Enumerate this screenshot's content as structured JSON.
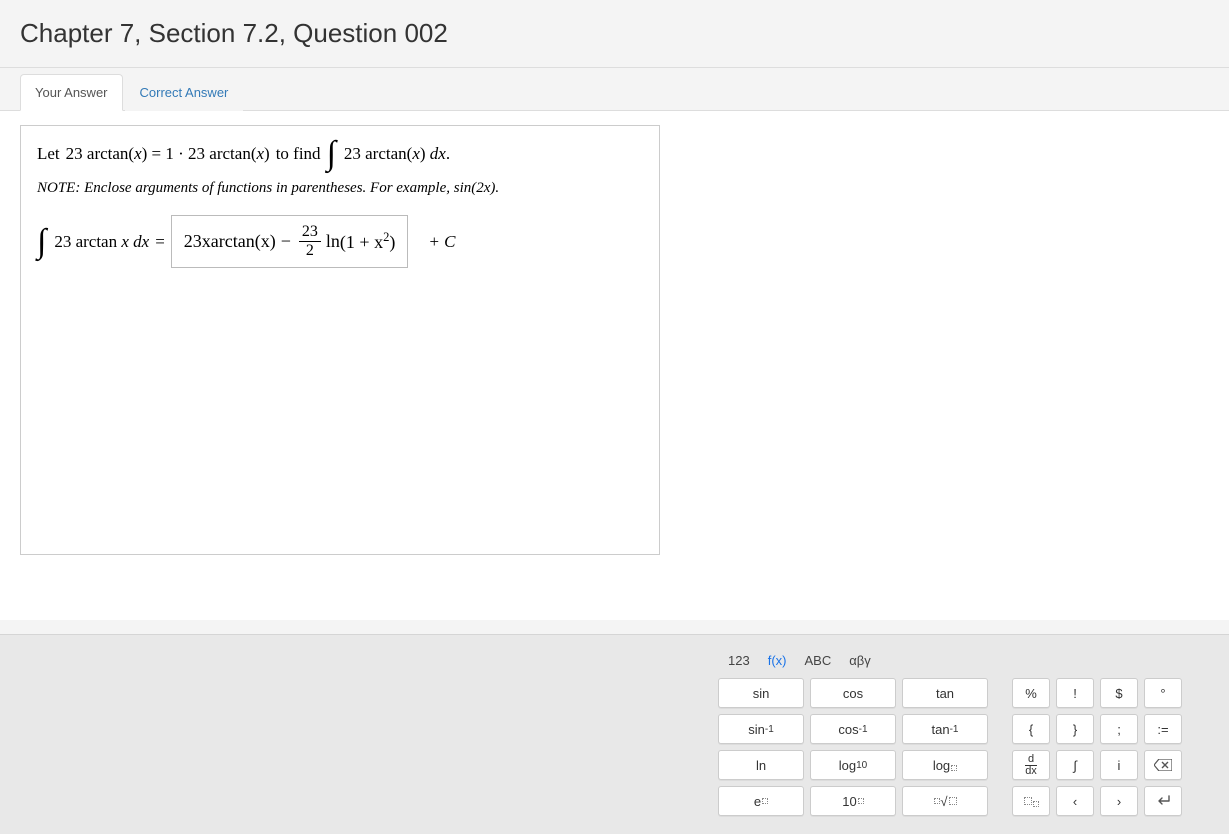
{
  "header": {
    "title": "Chapter 7, Section 7.2, Question 002"
  },
  "tabs": {
    "your_answer": "Your Answer",
    "correct_answer": "Correct Answer",
    "active": "your_answer"
  },
  "question": {
    "prompt_pre": "Let ",
    "prompt_eq_lhs": "23 arctan(x) = 1 · 23 arctan(x)",
    "prompt_mid": " to find ",
    "prompt_integrand": "23 arctan(x) dx.",
    "note": "NOTE: Enclose arguments of functions in parentheses. For example, sin(2x).",
    "answer_lhs_integrand": "23 arctan x dx",
    "answer_eq": " = ",
    "answer_input": {
      "term1": "23xarctan(x)",
      "minus": " − ",
      "frac_num": "23",
      "frac_den": "2",
      "term2_pre": " ln",
      "term2_arg": "(1 + x²)"
    },
    "plus_c": " + C"
  },
  "keyboard": {
    "tabs": {
      "t1": "123",
      "t2": "f(x)",
      "t3": "ABC",
      "t4": "αβγ",
      "active": "t2"
    },
    "rows": [
      {
        "wide": [
          "sin",
          "cos",
          "tan"
        ],
        "small": [
          "%",
          "!",
          "$",
          "°"
        ]
      },
      {
        "wide": [
          "sin⁻¹",
          "cos⁻¹",
          "tan⁻¹"
        ],
        "small": [
          "{",
          "}",
          ";",
          ":="
        ]
      },
      {
        "wide": [
          "ln",
          "log₁₀",
          "log□"
        ],
        "small": [
          "d/dx",
          "∫",
          "i",
          "⌫"
        ]
      },
      {
        "wide": [
          "e□",
          "10□",
          "ⁿ√□"
        ],
        "small": [
          "□□",
          "‹",
          "›",
          "↵"
        ]
      }
    ]
  }
}
